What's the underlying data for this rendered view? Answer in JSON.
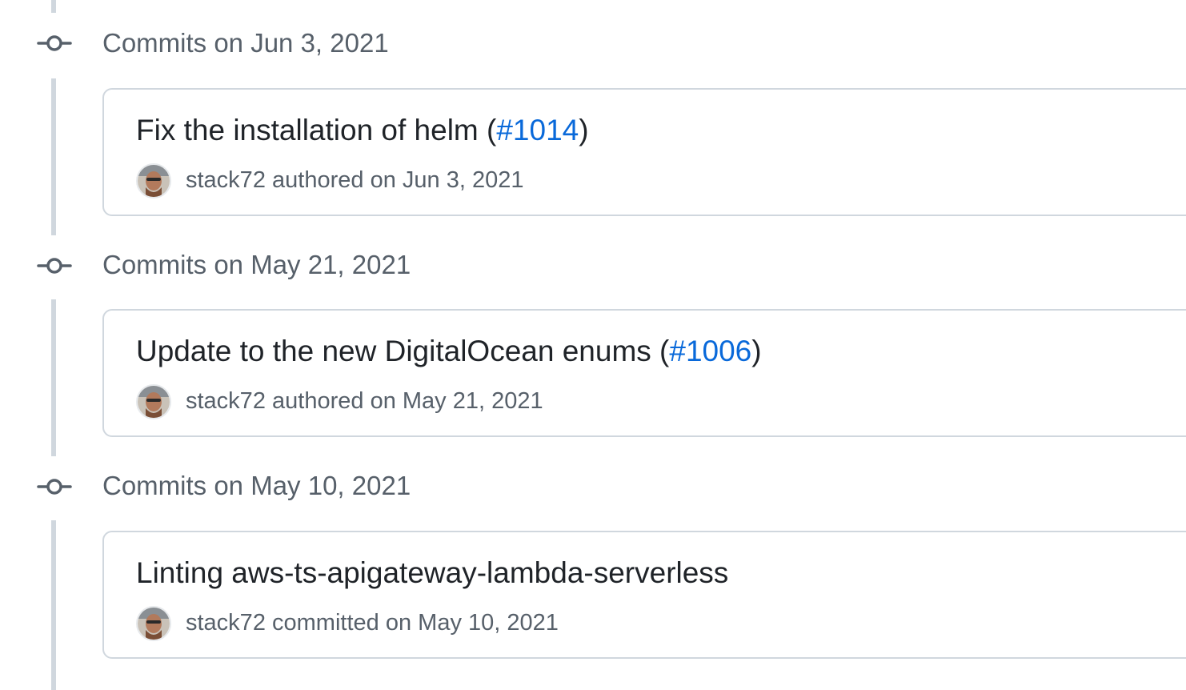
{
  "groups": [
    {
      "header": "Commits on Jun 3, 2021",
      "commit": {
        "title_text": "Fix the installation of helm (",
        "pr_link": "#1014",
        "title_suffix": ")",
        "author": "stack72",
        "action": "authored",
        "date_text": "on Jun 3, 2021"
      }
    },
    {
      "header": "Commits on May 21, 2021",
      "commit": {
        "title_text": "Update to the new DigitalOcean enums (",
        "pr_link": "#1006",
        "title_suffix": ")",
        "author": "stack72",
        "action": "authored",
        "date_text": "on May 21, 2021"
      }
    },
    {
      "header": "Commits on May 10, 2021",
      "commit": {
        "title_text": "Linting aws-ts-apigateway-lambda-serverless",
        "pr_link": "",
        "title_suffix": "",
        "author": "stack72",
        "action": "committed",
        "date_text": "on May 10, 2021"
      }
    }
  ],
  "colors": {
    "link": "#0969da",
    "muted": "#57606a",
    "border": "#d0d7de",
    "text": "#1f2328"
  },
  "icons": {
    "group_marker": "git-commit-icon",
    "avatar": "user-avatar"
  }
}
